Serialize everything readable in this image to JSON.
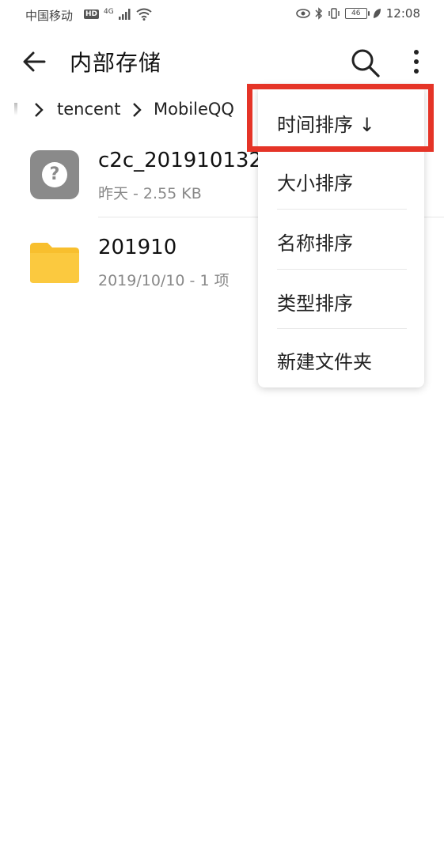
{
  "status_bar": {
    "carrier": "中国移动",
    "hd": "HD",
    "network": "4G",
    "battery": "46",
    "time": "12:08"
  },
  "toolbar": {
    "title": "内部存储"
  },
  "breadcrumb": {
    "items": [
      "tencent",
      "MobileQQ"
    ]
  },
  "files": [
    {
      "name": "c2c_201910132",
      "meta": "昨天 - 2.55 KB",
      "icon": "unknown-file-icon"
    },
    {
      "name": "201910",
      "meta": "2019/10/10 - 1 项",
      "icon": "folder-icon"
    }
  ],
  "menu": {
    "items": [
      "时间排序 ↓",
      "大小排序",
      "名称排序",
      "类型排序",
      "新建文件夹"
    ],
    "highlighted": "时间排序 ↓"
  },
  "colors": {
    "folder": "#f8bf2e",
    "unknown_icon": "#8a8a8a",
    "highlight": "#e53427"
  }
}
